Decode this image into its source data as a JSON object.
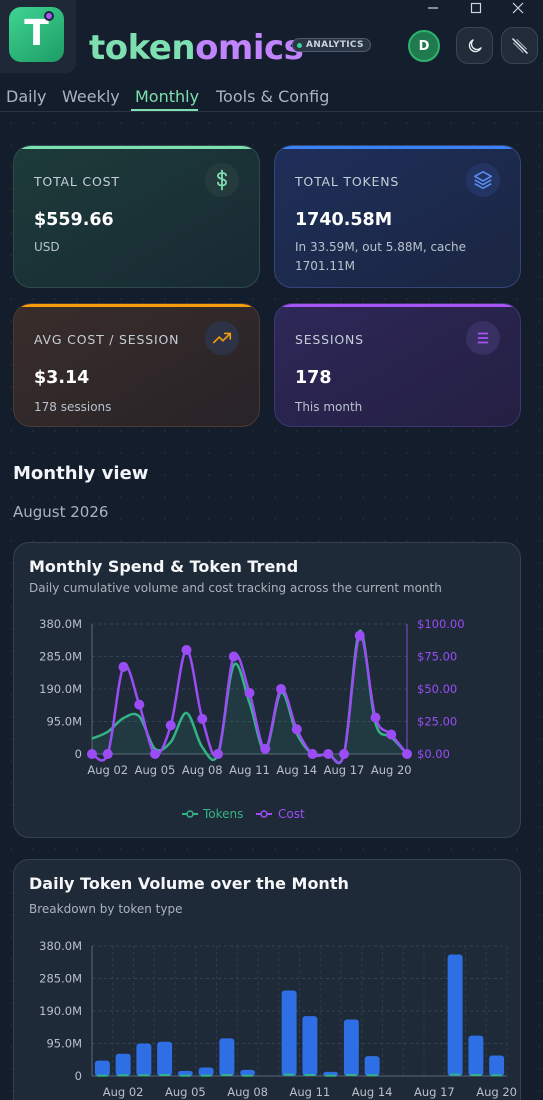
{
  "app": {
    "brand_a": "token",
    "brand_b": "omics",
    "logo_letter": "T",
    "badge": "ANALYTICS",
    "avatar_initial": "D"
  },
  "tabs": [
    {
      "label": "Daily"
    },
    {
      "label": "Weekly"
    },
    {
      "label": "Monthly",
      "active": true
    },
    {
      "label": "Tools & Config"
    }
  ],
  "stats": {
    "total_cost": {
      "label": "TOTAL COST",
      "value": "$559.66",
      "sub": "USD",
      "icon": "dollar-icon"
    },
    "total_tokens": {
      "label": "TOTAL TOKENS",
      "value": "1740.58M",
      "sub": "In 33.59M, out 5.88M, cache 1701.11M",
      "icon": "layers-icon"
    },
    "avg_cost": {
      "label": "AVG COST / SESSION",
      "value": "$3.14",
      "sub": "178 sessions",
      "icon": "trend-up-icon"
    },
    "sessions": {
      "label": "SESSIONS",
      "value": "178",
      "sub": "This month",
      "icon": "menu-icon"
    }
  },
  "section": {
    "title": "Monthly view",
    "period": "August 2026"
  },
  "colors": {
    "tokens": "#34b386",
    "cost": "#9b4df5",
    "bars": "#2f6fe6",
    "bars_small": "#34b386"
  },
  "chart_data": [
    {
      "type": "line",
      "title": "Monthly Spend & Token Trend",
      "subtitle": "Daily cumulative volume and cost tracking across the current month",
      "x": [
        "Aug 01",
        "Aug 02",
        "Aug 03",
        "Aug 04",
        "Aug 05",
        "Aug 06",
        "Aug 07",
        "Aug 08",
        "Aug 09",
        "Aug 10",
        "Aug 11",
        "Aug 12",
        "Aug 13",
        "Aug 14",
        "Aug 15",
        "Aug 16",
        "Aug 17",
        "Aug 18",
        "Aug 19",
        "Aug 20",
        "Aug 21"
      ],
      "x_ticks": [
        "Aug 02",
        "Aug 05",
        "Aug 08",
        "Aug 11",
        "Aug 14",
        "Aug 17",
        "Aug 20"
      ],
      "y_ticks_left": [
        "380.0M",
        "285.0M",
        "190.0M",
        "95.0M",
        "0"
      ],
      "y_ticks_right": [
        "$100.00",
        "$75.00",
        "$50.00",
        "$25.00",
        "$0.00"
      ],
      "ylim_left": [
        0,
        380
      ],
      "ylim_right": [
        0,
        100
      ],
      "legend_position": "bottom",
      "series": [
        {
          "name": "Tokens",
          "axis": "left",
          "values": [
            45,
            65,
            105,
            110,
            15,
            35,
            120,
            20,
            0,
            260,
            150,
            10,
            180,
            60,
            0,
            0,
            0,
            360,
            90,
            50,
            0
          ]
        },
        {
          "name": "Cost",
          "axis": "right",
          "values": [
            0,
            0,
            67,
            38,
            0,
            22,
            80,
            27,
            0,
            75,
            47,
            4,
            50,
            19,
            0,
            0,
            0,
            91,
            28,
            15,
            0
          ]
        }
      ]
    },
    {
      "type": "bar",
      "title": "Daily Token Volume over the Month",
      "subtitle": "Breakdown by token type",
      "x": [
        "Aug 01",
        "Aug 02",
        "Aug 03",
        "Aug 04",
        "Aug 05",
        "Aug 06",
        "Aug 07",
        "Aug 08",
        "Aug 09",
        "Aug 10",
        "Aug 11",
        "Aug 12",
        "Aug 13",
        "Aug 14",
        "Aug 15",
        "Aug 16",
        "Aug 17",
        "Aug 18",
        "Aug 19",
        "Aug 20"
      ],
      "x_ticks": [
        "Aug 02",
        "Aug 05",
        "Aug 08",
        "Aug 11",
        "Aug 14",
        "Aug 17",
        "Aug 20"
      ],
      "y_ticks": [
        "380.0M",
        "285.0M",
        "190.0M",
        "95.0M",
        "0"
      ],
      "ylim": [
        0,
        380
      ],
      "series": [
        {
          "values": [
            45,
            65,
            95,
            100,
            15,
            25,
            110,
            18,
            0,
            250,
            175,
            12,
            165,
            58,
            0,
            0,
            0,
            355,
            118,
            60
          ]
        },
        {
          "values": [
            1,
            2,
            2,
            3,
            1,
            1,
            3,
            1,
            0,
            4,
            3,
            1,
            3,
            2,
            0,
            0,
            0,
            4,
            3,
            2
          ]
        }
      ]
    }
  ]
}
